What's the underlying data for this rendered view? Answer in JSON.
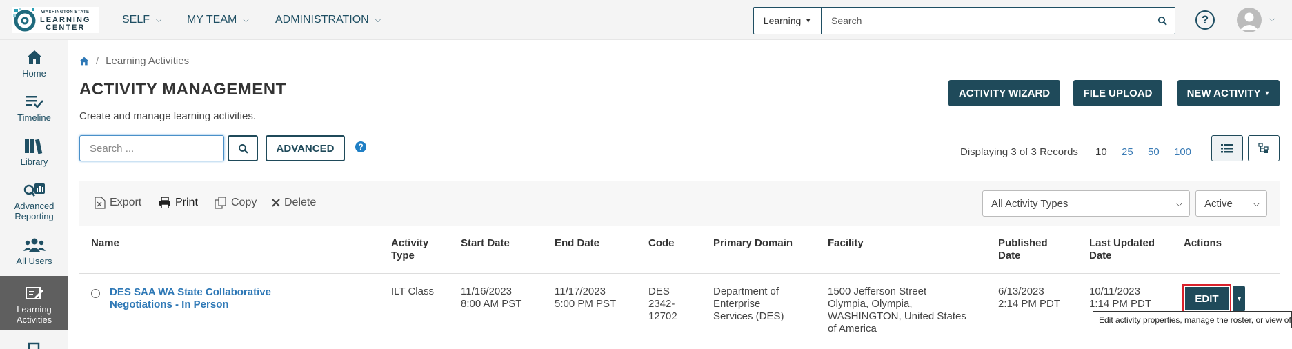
{
  "logo": {
    "line1": "WASHINGTON STATE",
    "line2": "LEARNING",
    "line3": "CENTER"
  },
  "nav": [
    {
      "label": "SELF"
    },
    {
      "label": "MY TEAM"
    },
    {
      "label": "ADMINISTRATION"
    }
  ],
  "search": {
    "scope": "Learning",
    "placeholder": "Search"
  },
  "help_glyph": "?",
  "sidebar": [
    {
      "label": "Home",
      "icon": "home-icon"
    },
    {
      "label": "Timeline",
      "icon": "timeline-icon"
    },
    {
      "label": "Library",
      "icon": "library-icon"
    },
    {
      "label": "Advanced Reporting",
      "icon": "reporting-icon"
    },
    {
      "label": "All Users",
      "icon": "users-icon"
    },
    {
      "label": "Learning Activities",
      "icon": "learning-activities-icon",
      "active": true
    }
  ],
  "breadcrumb": {
    "current": "Learning Activities"
  },
  "page": {
    "title": "ACTIVITY MANAGEMENT",
    "subtitle": "Create and manage learning activities."
  },
  "actions": {
    "wizard": "ACTIVITY WIZARD",
    "upload": "FILE UPLOAD",
    "new_activity": "NEW ACTIVITY"
  },
  "list_search": {
    "placeholder": "Search ...",
    "advanced": "ADVANCED"
  },
  "records": {
    "text": "Displaying 3 of 3 Records",
    "page_sizes": [
      "10",
      "25",
      "50",
      "100"
    ],
    "current_page_size": "10"
  },
  "toolbar": {
    "export": "Export",
    "print": "Print",
    "copy": "Copy",
    "delete": "Delete",
    "type_filter": "All Activity Types",
    "status_filter": "Active"
  },
  "table": {
    "headers": {
      "name": "Name",
      "activity_type": [
        "Activity",
        "Type"
      ],
      "start_date": "Start Date",
      "end_date": "End Date",
      "code": "Code",
      "primary_domain": "Primary Domain",
      "facility": "Facility",
      "published_date": [
        "Published",
        "Date"
      ],
      "last_updated": [
        "Last Updated",
        "Date"
      ],
      "actions": "Actions"
    },
    "rows": [
      {
        "name": [
          "DES SAA WA State Collaborative",
          "Negotiations - In Person"
        ],
        "activity_type": "ILT Class",
        "start_date": [
          "11/16/2023",
          "8:00 AM PST"
        ],
        "end_date": [
          "11/17/2023",
          "5:00 PM PST"
        ],
        "code": [
          "DES",
          "2342-",
          "12702"
        ],
        "primary_domain": [
          "Department of",
          "Enterprise",
          "Services (DES)"
        ],
        "facility": [
          "1500 Jefferson Street",
          "Olympia, Olympia,",
          "WASHINGTON, United States",
          "of America"
        ],
        "published_date": [
          "6/13/2023",
          "2:14 PM PDT"
        ],
        "last_updated": [
          "10/11/2023",
          "1:14 PM PDT"
        ],
        "edit_label": "EDIT"
      }
    ]
  },
  "tooltip": "Edit activity properties, manage the roster, or view of"
}
